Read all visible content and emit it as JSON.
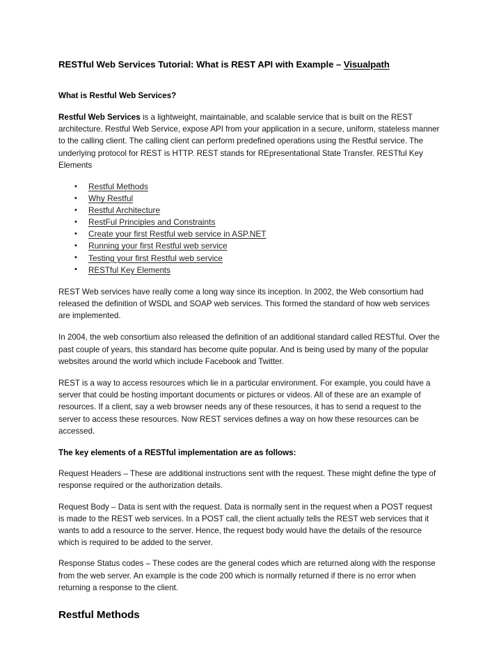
{
  "document": {
    "title_prefix": "RESTful Web Services Tutorial: What is REST API with Example – ",
    "title_link": "Visualpath",
    "heading_what_is": "What is Restful Web Services?",
    "intro": {
      "lead_bold": "Restful Web Services",
      "rest": " is a lightweight, maintainable, and scalable service that is built on the REST architecture. Restful Web Service, expose API from your application in a secure, uniform, stateless manner to the calling client. The calling client can perform predefined operations using the Restful service. The underlying protocol for REST is HTTP. REST stands for REpresentational State Transfer. RESTful Key Elements"
    },
    "toc": [
      {
        "label": "Restful Methods",
        "face": "arial"
      },
      {
        "label": "Why Restful",
        "face": "arial"
      },
      {
        "label": "Restful Architecture",
        "face": "arial"
      },
      {
        "label": "RestFul Principles and Constraints",
        "face": "arial"
      },
      {
        "label": "Create your first Restful web service in ASP.NET",
        "face": "arial"
      },
      {
        "label": "Running your first Restful web service",
        "face": "arial"
      },
      {
        "label": "Testing your first Restful web service",
        "face": "arial"
      },
      {
        "label": "RESTful Key Elements",
        "face": "body"
      }
    ],
    "paragraphs": {
      "history_2002": "REST Web services have really come a long way since its inception. In 2002, the Web consortium had released the definition of WSDL and SOAP web services. This formed the standard of how web services are implemented.",
      "history_2004": "In 2004, the web consortium also released the definition of an additional standard called RESTful. Over the past couple of years, this standard has become quite popular. And is being used by many of the popular websites around the world which include Facebook and Twitter.",
      "resources": "REST is a way to access resources which lie in a particular environment. For example, you could have a server that could be hosting important documents or pictures or videos. All of these are an example of resources. If a client, say a web browser needs any of these resources, it has to send a request to the server to access these resources. Now REST services defines a way on how these resources can be accessed.",
      "key_elements_heading": "The key elements of a RESTful implementation are as follows:",
      "request_headers": "Request Headers – These are additional instructions sent with the request. These might define the type of response required or the authorization details.",
      "request_body": "Request Body – Data is sent with the request. Data is normally sent in the request when a POST request is made to the REST web services. In a POST call, the client actually tells the REST web services that it wants to add a resource to the server. Hence, the request body would have the details of the resource which is required to be added to the server.",
      "response_status": "Response Status codes – These codes are the general codes which are returned along with the response from the web server. An example is the code 200 which is normally returned if there is no error when returning a response to the client."
    },
    "closing_heading": "Restful Methods"
  }
}
